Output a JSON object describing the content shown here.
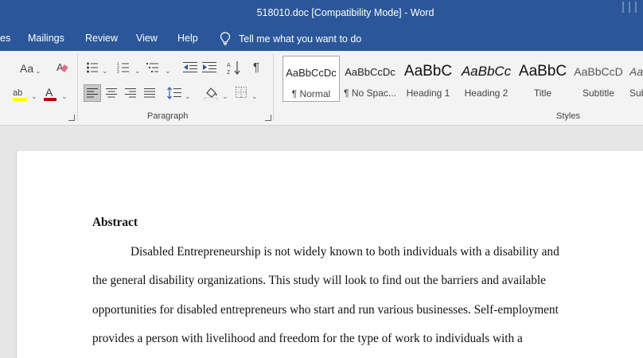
{
  "window": {
    "title": "518010.doc [Compatibility Mode]  -  Word"
  },
  "menu": {
    "tabs": [
      {
        "label": "es"
      },
      {
        "label": "Mailings"
      },
      {
        "label": "Review"
      },
      {
        "label": "View"
      },
      {
        "label": "Help"
      }
    ],
    "tell_me": "Tell me what you want to do"
  },
  "ribbon": {
    "groups": {
      "paragraph": "Paragraph",
      "styles": "Styles"
    },
    "font_case_label": "Aa",
    "styles": [
      {
        "preview": "AaBbCcDc",
        "name": "¶ Normal"
      },
      {
        "preview": "AaBbCcDc",
        "name": "¶ No Spac..."
      },
      {
        "preview": "AaBbC",
        "name": "Heading 1"
      },
      {
        "preview": "AaBbCc",
        "name": "Heading 2"
      },
      {
        "preview": "AaBbC",
        "name": "Title"
      },
      {
        "preview": "AaBbCcD",
        "name": "Subtitle"
      },
      {
        "preview": "Aa",
        "name": "Sub"
      }
    ]
  },
  "document": {
    "heading": "Abstract",
    "lines": [
      "Disabled Entrepreneurship is not widely known to both individuals with a disability and",
      "the general disability organizations. This study will look to find out the barriers and available",
      "opportunities for disabled entrepreneurs who start and run various businesses. Self-employment",
      "provides a person with livelihood and freedom for the type of work to individuals with a"
    ]
  },
  "colors": {
    "titlebar": "#2b579a",
    "ribbon": "#f3f3f3",
    "canvas": "#e6e6e6",
    "highlight": "#ffff00",
    "font_color": "#c00000"
  },
  "icons": [
    "lightbulb-icon",
    "case-icon",
    "clear-format-icon",
    "highlight-icon",
    "font-color-icon",
    "bullets-icon",
    "numbering-icon",
    "multilevel-icon",
    "decrease-indent-icon",
    "increase-indent-icon",
    "sort-icon",
    "pilcrow-icon",
    "align-left-icon",
    "align-center-icon",
    "align-right-icon",
    "justify-icon",
    "line-spacing-icon",
    "shading-icon",
    "borders-icon"
  ]
}
